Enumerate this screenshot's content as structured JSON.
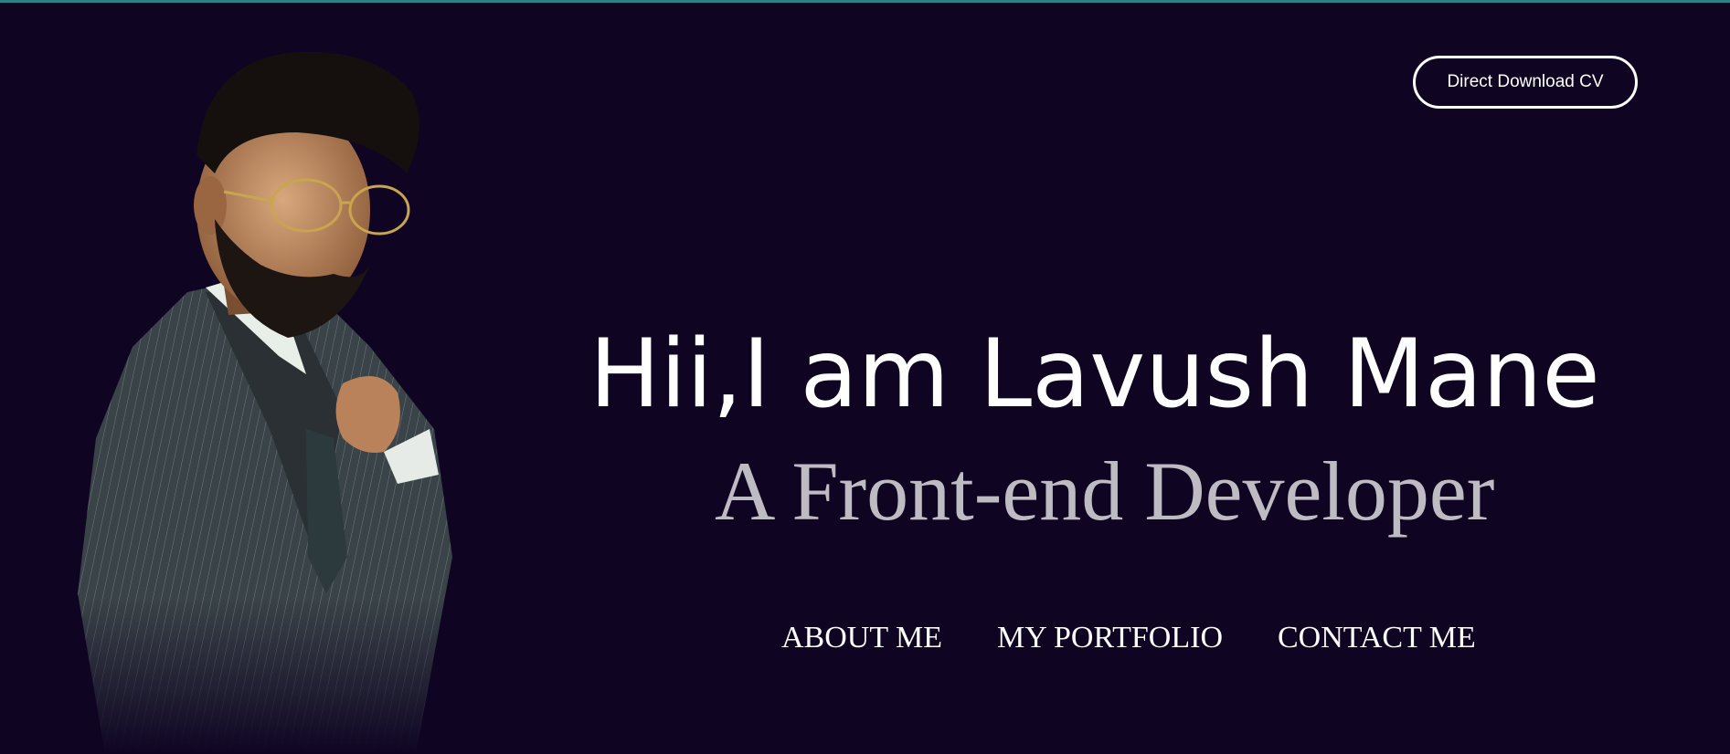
{
  "header": {
    "cv_button_label": "Direct Download CV"
  },
  "hero": {
    "title": "Hii,I am Lavush Mane",
    "subtitle": "A Front-end Developer",
    "portrait_icon": "person-portrait"
  },
  "nav": {
    "items": [
      {
        "label": "ABOUT ME"
      },
      {
        "label": "MY PORTFOLIO"
      },
      {
        "label": "CONTACT ME"
      }
    ]
  },
  "colors": {
    "background": "#0f0523",
    "accent_line": "#2f7f86",
    "subtitle": "#bebbc2",
    "text": "#ffffff"
  }
}
